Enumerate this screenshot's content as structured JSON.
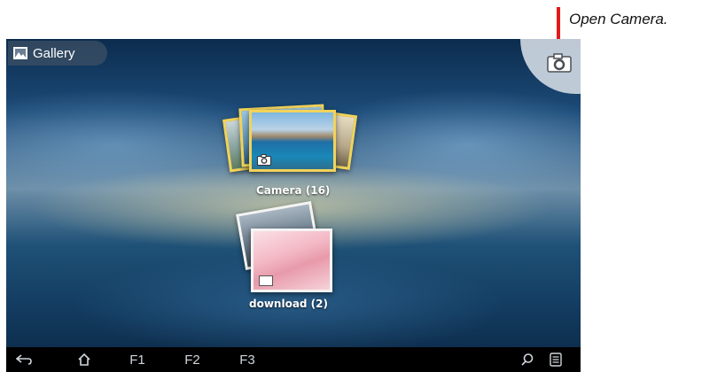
{
  "annotation": {
    "text": "Open Camera."
  },
  "header": {
    "gallery_label": "Gallery"
  },
  "albums": [
    {
      "name": "Camera",
      "count": "(16)",
      "label": "Camera  (16)"
    },
    {
      "name": "download",
      "count": "(2)",
      "label": "download  (2)"
    }
  ],
  "navbar": {
    "f1": "F1",
    "f2": "F2",
    "f3": "F3"
  },
  "colors": {
    "annotation_line": "#e01b1b",
    "selection": "#f1d35a",
    "navbar": "#000000"
  },
  "icons": [
    "gallery-icon",
    "camera-icon",
    "back-icon",
    "home-icon",
    "search-icon",
    "menu-icon"
  ]
}
